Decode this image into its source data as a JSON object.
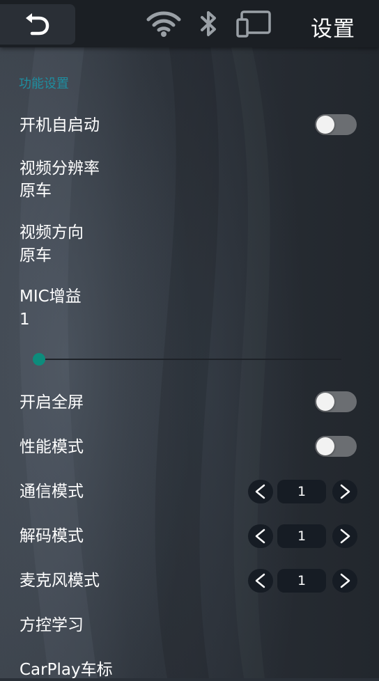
{
  "header": {
    "title": "设置",
    "icons": [
      "back-icon",
      "wifi-icon",
      "bluetooth-icon",
      "screen-cast-icon"
    ]
  },
  "section": {
    "title": "功能设置"
  },
  "settings": {
    "auto_start": {
      "label": "开机自启动",
      "on": false
    },
    "video_resolution": {
      "label": "视频分辨率",
      "value": "原车"
    },
    "video_orientation": {
      "label": "视频方向",
      "value": "原车"
    },
    "mic_gain": {
      "label": "MIC增益",
      "value": "1",
      "slider_fraction": 0.0
    },
    "fullscreen": {
      "label": "开启全屏",
      "on": false
    },
    "performance_mode": {
      "label": "性能模式",
      "on": false
    },
    "comm_mode": {
      "label": "通信模式",
      "value": "1"
    },
    "decode_mode": {
      "label": "解码模式",
      "value": "1"
    },
    "mic_mode": {
      "label": "麦克风模式",
      "value": "1"
    },
    "steering_learn": {
      "label": "方控学习"
    },
    "carplay_logo": {
      "label": "CarPlay车标"
    }
  },
  "colors": {
    "accent": "#1e8ea0",
    "slider_thumb": "#0d8c7c",
    "toggle_off_track": "#6b6e72",
    "header_bg": "#1b1f24"
  }
}
